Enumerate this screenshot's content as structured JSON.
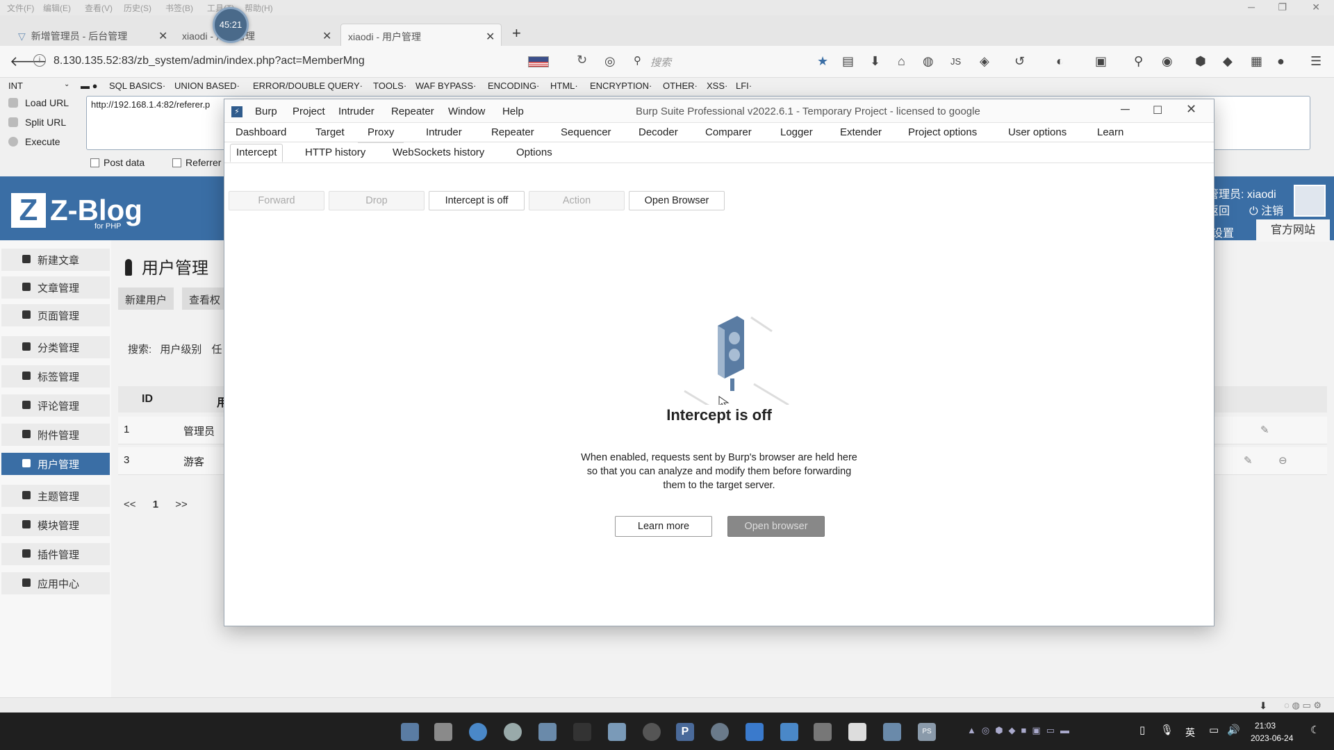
{
  "browser": {
    "menubar": [
      "文件(F)",
      "编辑(E)",
      "查看(V)",
      "历史(S)",
      "书签(B)",
      "工具(T)",
      "帮助(H)"
    ],
    "tabs": [
      {
        "title": "新增管理员 - 后台管理"
      },
      {
        "title": "xiaodi - 用户管理"
      },
      {
        "title": "xiaodi - 用户管理"
      }
    ],
    "timer": "45:21",
    "url": "8.130.135.52:83/zb_system/admin/index.php?act=MemberMng",
    "search_placeholder": "搜索",
    "hackbar": {
      "select_value": "INT",
      "menus": [
        "SQL BASICS·",
        "UNION BASED·",
        "ERROR/DOUBLE QUERY·",
        "TOOLS·",
        "WAF BYPASS·",
        "ENCODING·",
        "HTML·",
        "ENCRYPTION·",
        "OTHER·",
        "XSS·",
        "LFI·"
      ],
      "load_url": "Load URL",
      "split_url": "Split URL",
      "execute": "Execute",
      "url_value": "http://192.168.1.4:82/referer.p",
      "post_data": "Post data",
      "referrer": "Referrer"
    }
  },
  "zblog": {
    "logo_letter": "Z",
    "logo_name": "Z-Blog",
    "logo_sub": "for PHP",
    "user_label": "管理员: xiaodi",
    "return_label": "返回",
    "logout_label": "注销",
    "settings_label": "设置",
    "official_label": "官方网站",
    "sidebar": [
      {
        "label": "新建文章"
      },
      {
        "label": "文章管理"
      },
      {
        "label": "页面管理"
      },
      {
        "label": "分类管理"
      },
      {
        "label": "标签管理"
      },
      {
        "label": "评论管理"
      },
      {
        "label": "附件管理"
      },
      {
        "label": "用户管理"
      },
      {
        "label": "主题管理"
      },
      {
        "label": "模块管理"
      },
      {
        "label": "插件管理"
      },
      {
        "label": "应用中心"
      }
    ],
    "page_title": "用户管理",
    "new_user_btn": "新建用户",
    "view_perm_btn": "查看权",
    "search_label": "搜索:",
    "search_level": "用户级别",
    "search_any": "任",
    "table": {
      "col_id": "ID",
      "col_name": "用",
      "rows": [
        {
          "id": "1",
          "level": "管理员"
        },
        {
          "id": "3",
          "level": "游客"
        }
      ]
    },
    "pager": {
      "prev": "<<",
      "page": "1",
      "next": ">>"
    }
  },
  "burp": {
    "menus": [
      "Burp",
      "Project",
      "Intruder",
      "Repeater",
      "Window",
      "Help"
    ],
    "window_title": "Burp Suite Professional v2022.6.1 - Temporary Project - licensed to google",
    "tabs": [
      "Dashboard",
      "Target",
      "Proxy",
      "Intruder",
      "Repeater",
      "Sequencer",
      "Decoder",
      "Comparer",
      "Logger",
      "Extender",
      "Project options",
      "User options",
      "Learn"
    ],
    "subtabs": [
      "Intercept",
      "HTTP history",
      "WebSockets history",
      "Options"
    ],
    "buttons": {
      "forward": "Forward",
      "drop": "Drop",
      "intercept": "Intercept is off",
      "action": "Action",
      "open_browser": "Open Browser"
    },
    "heading": "Intercept is off",
    "desc_line1": "When enabled, requests sent by Burp's browser are held here",
    "desc_line2": "so that you can analyze and modify them before forwarding",
    "desc_line3": "them to the target server.",
    "learn_more": "Learn more",
    "open_browser2": "Open browser"
  },
  "taskbar": {
    "time": "21:03",
    "date": "2023-06-24",
    "lang": "英"
  },
  "colors": {
    "zblog_blue": "#3a6ea5",
    "burp_orange": "#e8632b",
    "taskbar": "#1f1f1f"
  }
}
